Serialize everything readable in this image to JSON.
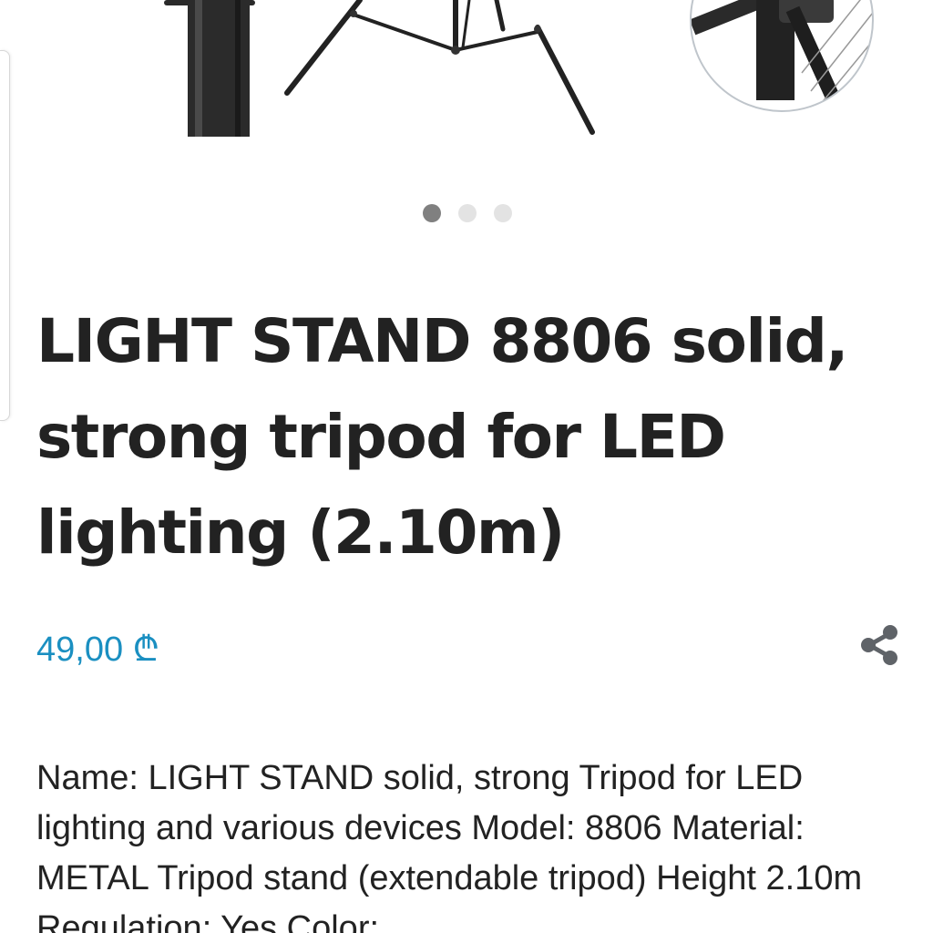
{
  "product": {
    "title": "LIGHT STAND 8806 solid, strong tripod for LED lighting (2.10m)",
    "price": "49,00 ₾",
    "description": "Name: LIGHT STAND solid, strong Tripod for LED lighting and various devices Model: 8806 Material: METAL Tripod stand (extendable tripod) Height 2.10m Regulation: Yes Color:"
  },
  "gallery": {
    "slide_count": 3,
    "active_slide": 1
  },
  "icons": {
    "share": "share-icon"
  },
  "colors": {
    "price": "#1a8fc1",
    "title": "#222222",
    "dot_active": "#808080",
    "dot_inactive": "#e3e3e3"
  }
}
